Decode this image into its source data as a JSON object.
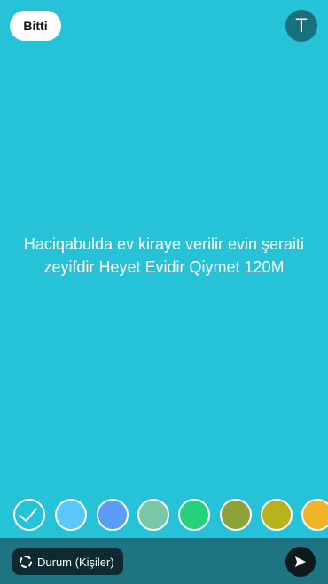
{
  "header": {
    "done_label": "Bitti",
    "text_tool_label": "T"
  },
  "status_text": "Haciqabulda ev kiraye verilir evin şeraiti zeyifdir Heyet Evidir Qiymet 120M",
  "background_color": "#26c2d8",
  "palette": {
    "selected_index": 0,
    "colors": [
      "#26c2d8",
      "#5ac8fa",
      "#5b9cf5",
      "#79c7a7",
      "#26d07c",
      "#8ea23a",
      "#b7b31e",
      "#f0b428"
    ]
  },
  "footer": {
    "audience_label": "Durum (Kişiler)",
    "status_icon": "status-ring-icon",
    "send_icon": "send-icon"
  }
}
